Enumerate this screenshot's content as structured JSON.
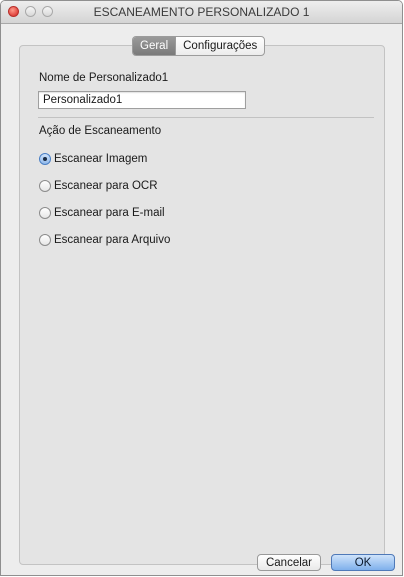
{
  "window": {
    "title": "ESCANEAMENTO PERSONALIZADO 1"
  },
  "tabs": [
    {
      "label": "Geral",
      "active": true
    },
    {
      "label": "Configurações",
      "active": false
    }
  ],
  "name_field": {
    "label": "Nome de Personalizado1",
    "value": "Personalizado1"
  },
  "scan_action": {
    "label": "Ação de Escaneamento",
    "options": [
      {
        "label": "Escanear Imagem",
        "selected": true
      },
      {
        "label": "Escanear para OCR",
        "selected": false
      },
      {
        "label": "Escanear para E-mail",
        "selected": false
      },
      {
        "label": "Escanear para Arquivo",
        "selected": false
      }
    ]
  },
  "buttons": {
    "cancel": "Cancelar",
    "ok": "OK"
  }
}
